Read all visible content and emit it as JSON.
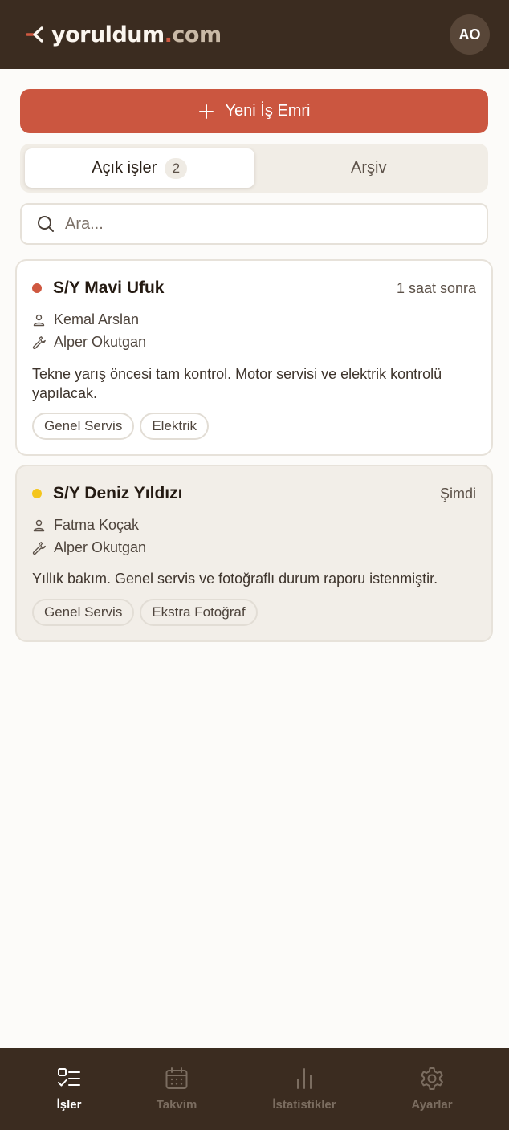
{
  "header": {
    "logo_brand": "yoruldum",
    "logo_dot": ".",
    "logo_tld": "com",
    "avatar_initials": "AO"
  },
  "actions": {
    "new_order_label": "Yeni İş Emri"
  },
  "tabs": [
    {
      "label": "Açık işler",
      "count": "2",
      "active": true
    },
    {
      "label": "Arşiv",
      "active": false
    }
  ],
  "search": {
    "placeholder": "Ara..."
  },
  "jobs": [
    {
      "vessel": "S/Y Mavi Ufuk",
      "time": "1 saat sonra",
      "status_color": "#cf5840",
      "owner": "Kemal Arslan",
      "technician": "Alper Okutgan",
      "description": "Tekne yarış öncesi tam kontrol. Motor servisi ve elektrik kontrolü yapılacak.",
      "tags": [
        "Genel Servis",
        "Elektrik"
      ]
    },
    {
      "vessel": "S/Y Deniz Yıldızı",
      "time": "Şimdi",
      "status_color": "#f4c51c",
      "owner": "Fatma Koçak",
      "technician": "Alper Okutgan",
      "description": "Yıllık bakım. Genel servis ve fotoğraflı durum raporu istenmiştir.",
      "tags": [
        "Genel Servis",
        "Ekstra Fotoğraf"
      ]
    }
  ],
  "bottom_nav": [
    {
      "label": "İşler",
      "icon": "tasks-icon",
      "active": true
    },
    {
      "label": "Takvim",
      "icon": "calendar-icon",
      "active": false
    },
    {
      "label": "İstatistikler",
      "icon": "stats-icon",
      "active": false
    },
    {
      "label": "Ayarlar",
      "icon": "gear-icon",
      "active": false
    }
  ],
  "colors": {
    "header_bg": "#3b2c20",
    "accent": "#cb5640",
    "page_bg": "#fcfbf9"
  }
}
